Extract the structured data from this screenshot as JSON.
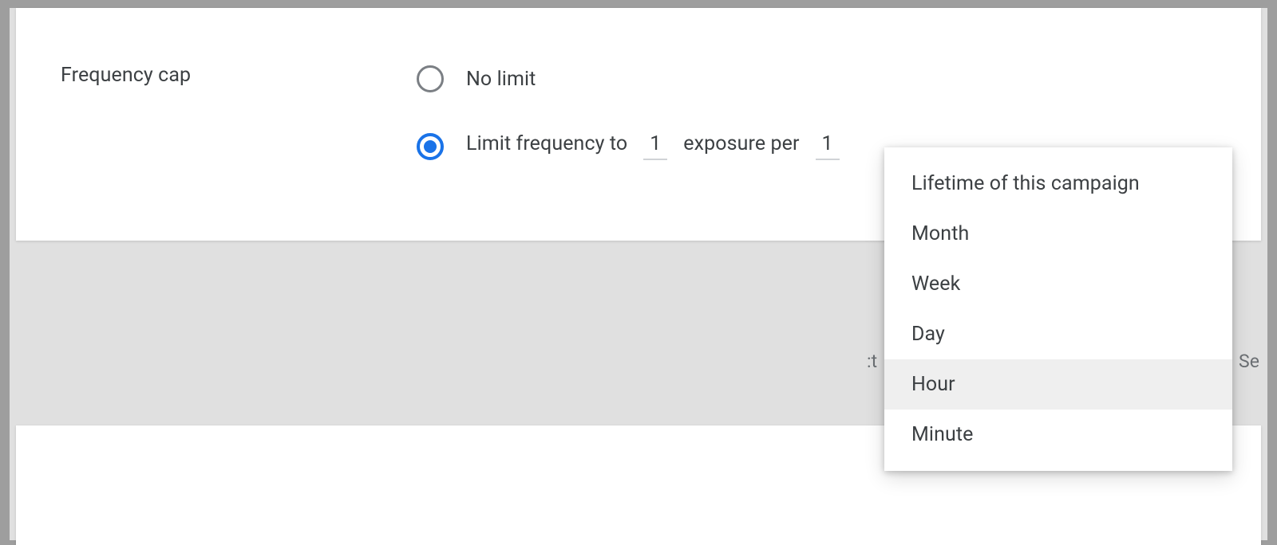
{
  "setting": {
    "label": "Frequency cap",
    "options": {
      "no_limit": "No limit",
      "limit_prefix": "Limit frequency to",
      "limit_mid": "exposure per",
      "exposures_value": "1",
      "period_count_value": "1"
    }
  },
  "dropdown": {
    "items": [
      "Lifetime of this campaign",
      "Month",
      "Week",
      "Day",
      "Hour",
      "Minute"
    ],
    "selected_index": 4
  },
  "background_fragments": {
    "left": ":t",
    "right": "Se"
  }
}
